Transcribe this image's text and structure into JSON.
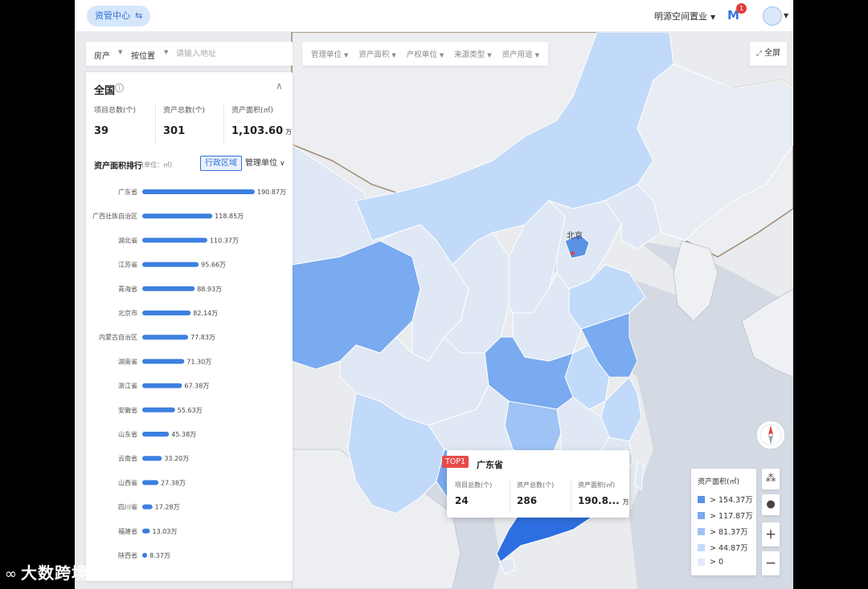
{
  "topbar": {
    "menu_label": "资管中心",
    "menu_switch_icon": "⇆",
    "org_name": "明源空间置业",
    "notification_count": "1"
  },
  "search": {
    "type_value": "房产",
    "mode_value": "按位置",
    "placeholder": "请输入地址"
  },
  "filters": [
    {
      "label": "管理单位"
    },
    {
      "label": "资产面积"
    },
    {
      "label": "产权单位"
    },
    {
      "label": "来源类型"
    },
    {
      "label": "资产用途"
    }
  ],
  "fullscreen_label": "全屏",
  "panel": {
    "title": "全国",
    "stats": [
      {
        "label": "项目总数(个)",
        "value": "39",
        "unit": ""
      },
      {
        "label": "资产总数(个)",
        "value": "301",
        "unit": ""
      },
      {
        "label": "资产面积(㎡)",
        "value": "1,103.60",
        "unit": "万"
      }
    ],
    "ranking_title": "资产面积排行",
    "ranking_unit": "(单位：㎡)",
    "toggle_active": "行政区域",
    "toggle_inactive": "管理单位"
  },
  "chart_data": {
    "type": "bar",
    "orientation": "horizontal",
    "title": "资产面积排行",
    "unit": "㎡",
    "categories": [
      "广东省",
      "广西壮族自治区",
      "湖北省",
      "江苏省",
      "青海省",
      "北京市",
      "内蒙古自治区",
      "湖南省",
      "浙江省",
      "安徽省",
      "山东省",
      "云南省",
      "山西省",
      "四川省",
      "福建省",
      "陕西省"
    ],
    "values": [
      190.87,
      118.85,
      110.37,
      95.66,
      88.93,
      82.14,
      77.83,
      71.3,
      67.38,
      55.63,
      45.38,
      33.2,
      27.38,
      17.28,
      13.03,
      8.37
    ],
    "value_labels": [
      "190.87万",
      "118.85万",
      "110.37万",
      "95.66万",
      "88.93万",
      "82.14万",
      "77.83万",
      "71.30万",
      "67.38万",
      "55.63万",
      "45.38万",
      "33.20万",
      "27.38万",
      "17.28万",
      "13.03万",
      "8.37万"
    ],
    "bar_color": "#3d7fe0"
  },
  "map": {
    "label_beijing": "北京"
  },
  "tooltip": {
    "tag": "TOP1",
    "province": "广东省",
    "cols": [
      {
        "label": "项目总数(个)",
        "value": "24",
        "unit": ""
      },
      {
        "label": "资产总数(个)",
        "value": "286",
        "unit": ""
      },
      {
        "label": "资产面积(㎡)",
        "value": "190.8...",
        "unit": "万"
      }
    ]
  },
  "legend": {
    "title": "资产面积(㎡)",
    "items": [
      {
        "label": ">  154.37万",
        "color": "#5a93e6"
      },
      {
        "label": ">  117.87万",
        "color": "#7aaaf0"
      },
      {
        "label": ">  81.37万",
        "color": "#9fc3f5"
      },
      {
        "label": ">  44.87万",
        "color": "#c2daf9"
      },
      {
        "label": ">  0",
        "color": "#dfeafa"
      }
    ]
  },
  "controls": {
    "zoom_in": "+",
    "zoom_out": "−"
  },
  "watermark": "大数跨境"
}
